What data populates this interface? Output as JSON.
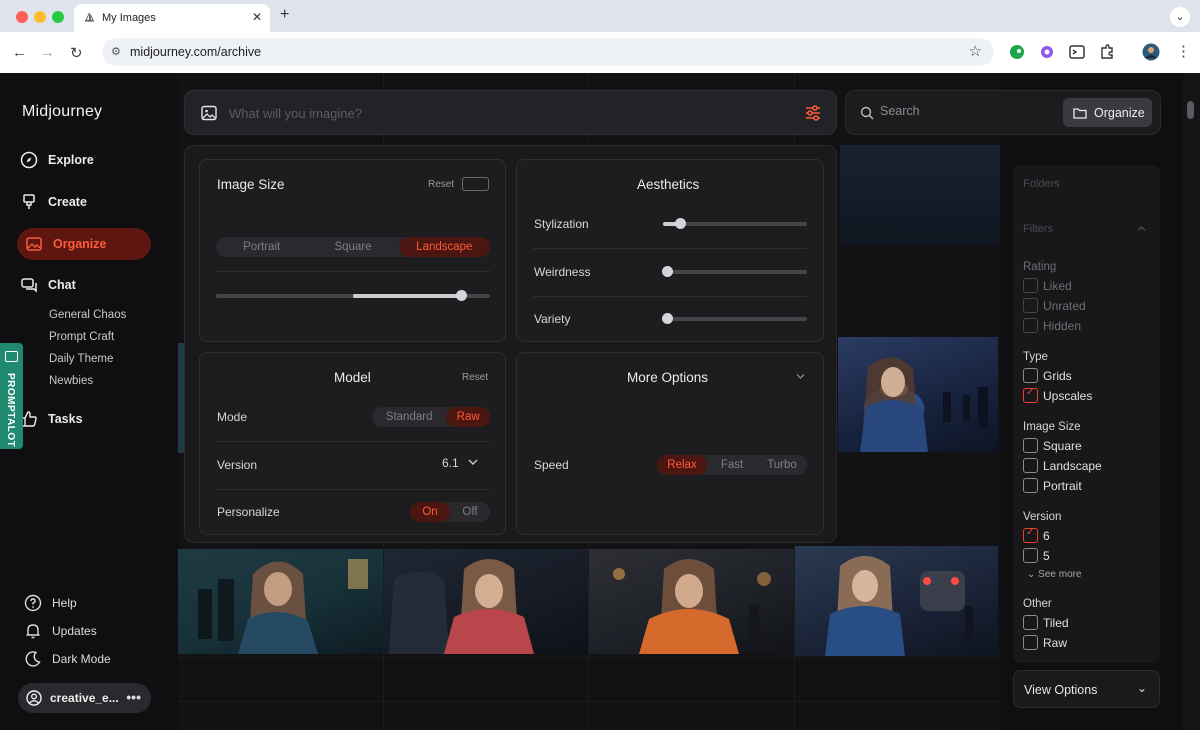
{
  "browser": {
    "tab_title": "My Images",
    "url": "midjourney.com/archive"
  },
  "sidebar": {
    "brand": "Midjourney",
    "items": [
      {
        "label": "Explore",
        "icon": "compass-icon"
      },
      {
        "label": "Create",
        "icon": "brush-icon"
      },
      {
        "label": "Organize",
        "icon": "image-icon",
        "active": true
      },
      {
        "label": "Chat",
        "icon": "chat-icon"
      },
      {
        "label": "Tasks",
        "icon": "thumbs-up-icon"
      }
    ],
    "chat_rooms": [
      "General Chaos",
      "Prompt Craft",
      "Daily Theme",
      "Newbies"
    ],
    "bottom": [
      {
        "label": "Help",
        "icon": "help-icon"
      },
      {
        "label": "Updates",
        "icon": "bell-icon"
      },
      {
        "label": "Dark Mode",
        "icon": "moon-icon"
      }
    ],
    "user": "creative_e...",
    "extension_tab": "PROMPTALOT"
  },
  "prompt": {
    "placeholder": "What will you imagine?"
  },
  "settings": {
    "image_size": {
      "title": "Image Size",
      "reset": "Reset",
      "options": [
        "Portrait",
        "Square",
        "Landscape"
      ],
      "selected": "Landscape",
      "slider_value": 0.9
    },
    "aesthetics": {
      "title": "Aesthetics",
      "sliders": [
        {
          "label": "Stylization",
          "value": 0.12
        },
        {
          "label": "Weirdness",
          "value": 0.02
        },
        {
          "label": "Variety",
          "value": 0.02
        }
      ]
    },
    "model": {
      "title": "Model",
      "reset": "Reset",
      "mode_label": "Mode",
      "mode_options": [
        "Standard",
        "Raw"
      ],
      "mode_selected": "Raw",
      "version_label": "Version",
      "version_value": "6.1",
      "personalize_label": "Personalize",
      "personalize_options": [
        "On",
        "Off"
      ],
      "personalize_selected": "On"
    },
    "more_options": {
      "title": "More Options",
      "speed_label": "Speed",
      "speed_options": [
        "Relax",
        "Fast",
        "Turbo"
      ],
      "speed_selected": "Relax"
    }
  },
  "search": {
    "placeholder": "Search",
    "organize_label": "Organize"
  },
  "filters": {
    "faded_header_1": "Folders",
    "faded_header_2": "Filters",
    "rating_title": "Rating",
    "rating": [
      "Liked",
      "Unrated",
      "Hidden"
    ],
    "type_title": "Type",
    "type": [
      {
        "label": "Grids",
        "checked": false
      },
      {
        "label": "Upscales",
        "checked": true
      }
    ],
    "size_title": "Image Size",
    "size": [
      {
        "label": "Square",
        "checked": false
      },
      {
        "label": "Landscape",
        "checked": false
      },
      {
        "label": "Portrait",
        "checked": false
      }
    ],
    "version_title": "Version",
    "version": [
      {
        "label": "6",
        "checked": true
      },
      {
        "label": "5",
        "checked": false
      }
    ],
    "see_more": "See more",
    "other_title": "Other",
    "other": [
      {
        "label": "Tiled",
        "checked": false
      },
      {
        "label": "Raw",
        "checked": false
      }
    ],
    "view_options": "View Options"
  },
  "colors": {
    "accent": "#ff5b3a",
    "accent_bg": "#5d1610",
    "panel": "#1a1a1d",
    "extension": "#1f8a70"
  }
}
